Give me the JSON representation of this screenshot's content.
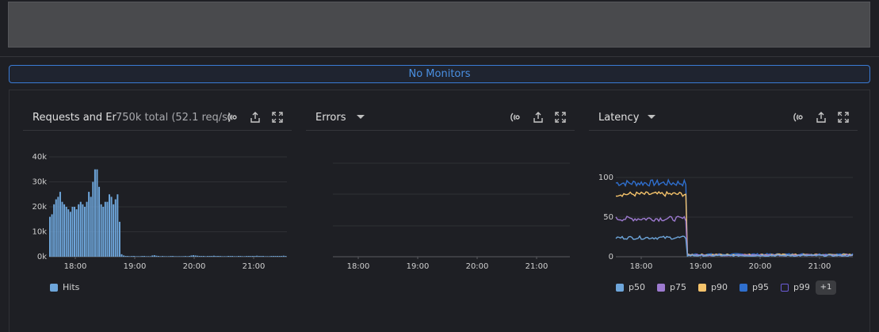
{
  "monitors_banner": {
    "label": "No Monitors"
  },
  "panels": {
    "requests": {
      "title": "Requests and Er",
      "subtitle": "750k total (52.1 req/s)",
      "legend": [
        {
          "label": "Hits",
          "color": "#6ea6db"
        }
      ]
    },
    "errors": {
      "title": "Errors"
    },
    "latency": {
      "title": "Latency",
      "legend": [
        {
          "label": "p50",
          "color": "#6ea6db"
        },
        {
          "label": "p75",
          "color": "#9d7ad0"
        },
        {
          "label": "p90",
          "color": "#f5c36b"
        },
        {
          "label": "p95",
          "color": "#2f6fce"
        },
        {
          "label": "p99",
          "color": "#6b5bd6",
          "hollow": true
        }
      ],
      "more_label": "+1"
    }
  },
  "chart_data": [
    {
      "type": "bar",
      "title": "Requests and Er",
      "xticks": [
        "18:00",
        "19:00",
        "20:00",
        "21:00"
      ],
      "yticks": [
        "0k",
        "10k",
        "20k",
        "30k",
        "40k"
      ],
      "ylim": [
        0,
        40000
      ],
      "series": [
        {
          "name": "Hits",
          "color": "#6ea6db",
          "values": [
            16000,
            17000,
            21000,
            23000,
            24000,
            26000,
            22000,
            21000,
            20000,
            19000,
            18000,
            20000,
            20000,
            19000,
            21000,
            22000,
            21000,
            20000,
            22000,
            26000,
            24000,
            30000,
            35000,
            35000,
            28000,
            21000,
            20000,
            22000,
            22000,
            25000,
            24000,
            21000,
            23000,
            25000,
            14000,
            1000,
            500,
            300,
            300,
            200,
            300,
            300,
            200,
            200,
            200,
            300,
            300,
            200,
            200,
            200,
            500,
            600,
            400,
            300,
            200,
            300,
            200,
            200,
            200,
            300,
            300,
            200,
            200,
            200,
            200,
            200,
            300,
            200,
            300,
            500,
            600,
            500,
            400,
            300,
            300,
            300,
            200,
            300,
            300,
            300,
            400,
            300,
            300,
            300,
            200,
            200,
            200,
            300,
            300,
            300,
            200,
            200,
            300,
            300,
            200,
            200,
            300,
            300,
            300,
            300,
            300,
            400,
            300,
            300,
            300,
            200,
            200,
            200,
            300,
            300,
            300,
            300,
            300,
            300,
            400,
            300
          ]
        }
      ]
    },
    {
      "type": "line",
      "title": "Errors",
      "xticks": [
        "18:00",
        "19:00",
        "20:00",
        "21:00"
      ],
      "series": []
    },
    {
      "type": "line",
      "title": "Latency",
      "xticks": [
        "18:00",
        "19:00",
        "20:00",
        "21:00"
      ],
      "yticks": [
        "0",
        "50",
        "100"
      ],
      "ylim": [
        0,
        110
      ],
      "step_fraction": 0.3,
      "series": [
        {
          "name": "p50",
          "color": "#6ea6db",
          "before": 24,
          "after": 1.5,
          "noise": 2
        },
        {
          "name": "p75",
          "color": "#9d7ad0",
          "before": 48,
          "after": 2,
          "noise": 3
        },
        {
          "name": "p90",
          "color": "#f5c36b",
          "before": 79,
          "after": 2.5,
          "noise": 3
        },
        {
          "name": "p95",
          "color": "#2f6fce",
          "before": 93,
          "after": 3,
          "noise": 4
        }
      ]
    }
  ]
}
